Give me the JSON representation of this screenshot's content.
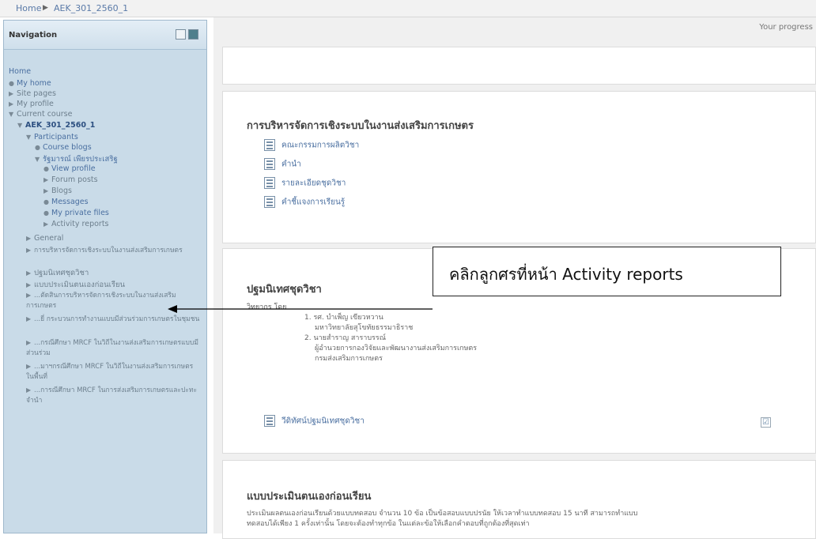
{
  "breadcrumb": {
    "home": "Home",
    "separator": "▶",
    "course": "AEK_301_2560_1"
  },
  "navigation": {
    "title": "Navigation",
    "items": [
      {
        "label": "Home"
      },
      {
        "label": "My home"
      },
      {
        "label": "Site pages"
      },
      {
        "label": "My profile"
      },
      {
        "label": "Current course"
      },
      {
        "label": "AEK_301_2560_1"
      },
      {
        "label": "Participants"
      },
      {
        "label": "Course blogs"
      },
      {
        "label": "รัฐมารณ์ เพียรประเสริฐ"
      },
      {
        "label": "View profile"
      },
      {
        "label": "Forum posts"
      },
      {
        "label": "Blogs"
      },
      {
        "label": "Messages"
      },
      {
        "label": "My private files"
      },
      {
        "label": "Activity reports"
      },
      {
        "label": "General"
      },
      {
        "label": "การบริหารจัดการเชิงระบบในงานส่งเสริมการเกษตร"
      },
      {
        "label": "ปฐมนิเทศชุดวิชา"
      },
      {
        "label": "แบบประเมินตนเองก่อนเรียน"
      },
      {
        "label": "...ตัดสินการบริหารจัดการเชิงระบบในงานส่งเสริมการเกษตร"
      },
      {
        "label": "...ยี่ กระบวนการทำงานแบบมีส่วนร่วมการเกษตรในชุมชน"
      },
      {
        "label": "...กรณีศึกษา MRCF ในวิถีในงานส่งเสริมการเกษตรแบบมีส่วนร่วม"
      },
      {
        "label": "...มาฯกรณีศึกษา MRCF ในวิถีในงานส่งเสริมการเกษตรในพื้นที่"
      },
      {
        "label": "...การณีศึกษา MRCF ในการส่งเสริมการเกษตรและปะทะจำนำ"
      }
    ]
  },
  "main": {
    "progress_label": "Your progress",
    "section1": {
      "title": "การบริหารจัดการเชิงระบบในงานส่งเสริมการเกษตร",
      "resources": [
        "คณะกรรมการผลิตวิชา",
        "คำนำ",
        "รายละเอียดชุดวิชา",
        "คำชี้แจงการเรียนรู้"
      ]
    },
    "section2": {
      "title": "ปฐมนิเทศชุดวิชา",
      "heading": "วิทยากร โดย",
      "lines": [
        "1. รศ. บำเพ็ญ  เขียวหวาน",
        "มหาวิทยาลัยสุโขทัยธรรมาธิราช",
        "2. นายสำราญ  สาราบรรณ์",
        "ผู้อำนวยการกองวิจัยและพัฒนางานส่งเสริมการเกษตร",
        "กรมส่งเสริมการเกษตร"
      ],
      "video": "วีดิทัศน์ปฐมนิเทศชุดวิชา",
      "checkbox": "☑"
    },
    "section3": {
      "title": "แบบประเมินตนเองก่อนเรียน",
      "desc1": "ประเมินผลตนเองก่อนเรียนด้วยแบบทดสอบ จำนวน 10 ข้อ เป็นข้อสอบแบบปรนัย ให้เวลาทำแบบทดสอบ 15 นาที สามารถทำแบบ",
      "desc2": "ทดสอบได้เพียง 1 ครั้งเท่านั้น โดยจะต้องทำทุกข้อ ในแต่ละข้อให้เลือกคำตอบที่ถูกต้องที่สุดเท่า"
    }
  },
  "annotation": {
    "callout_text": "คลิกลูกศรที่หน้า Activity reports"
  }
}
